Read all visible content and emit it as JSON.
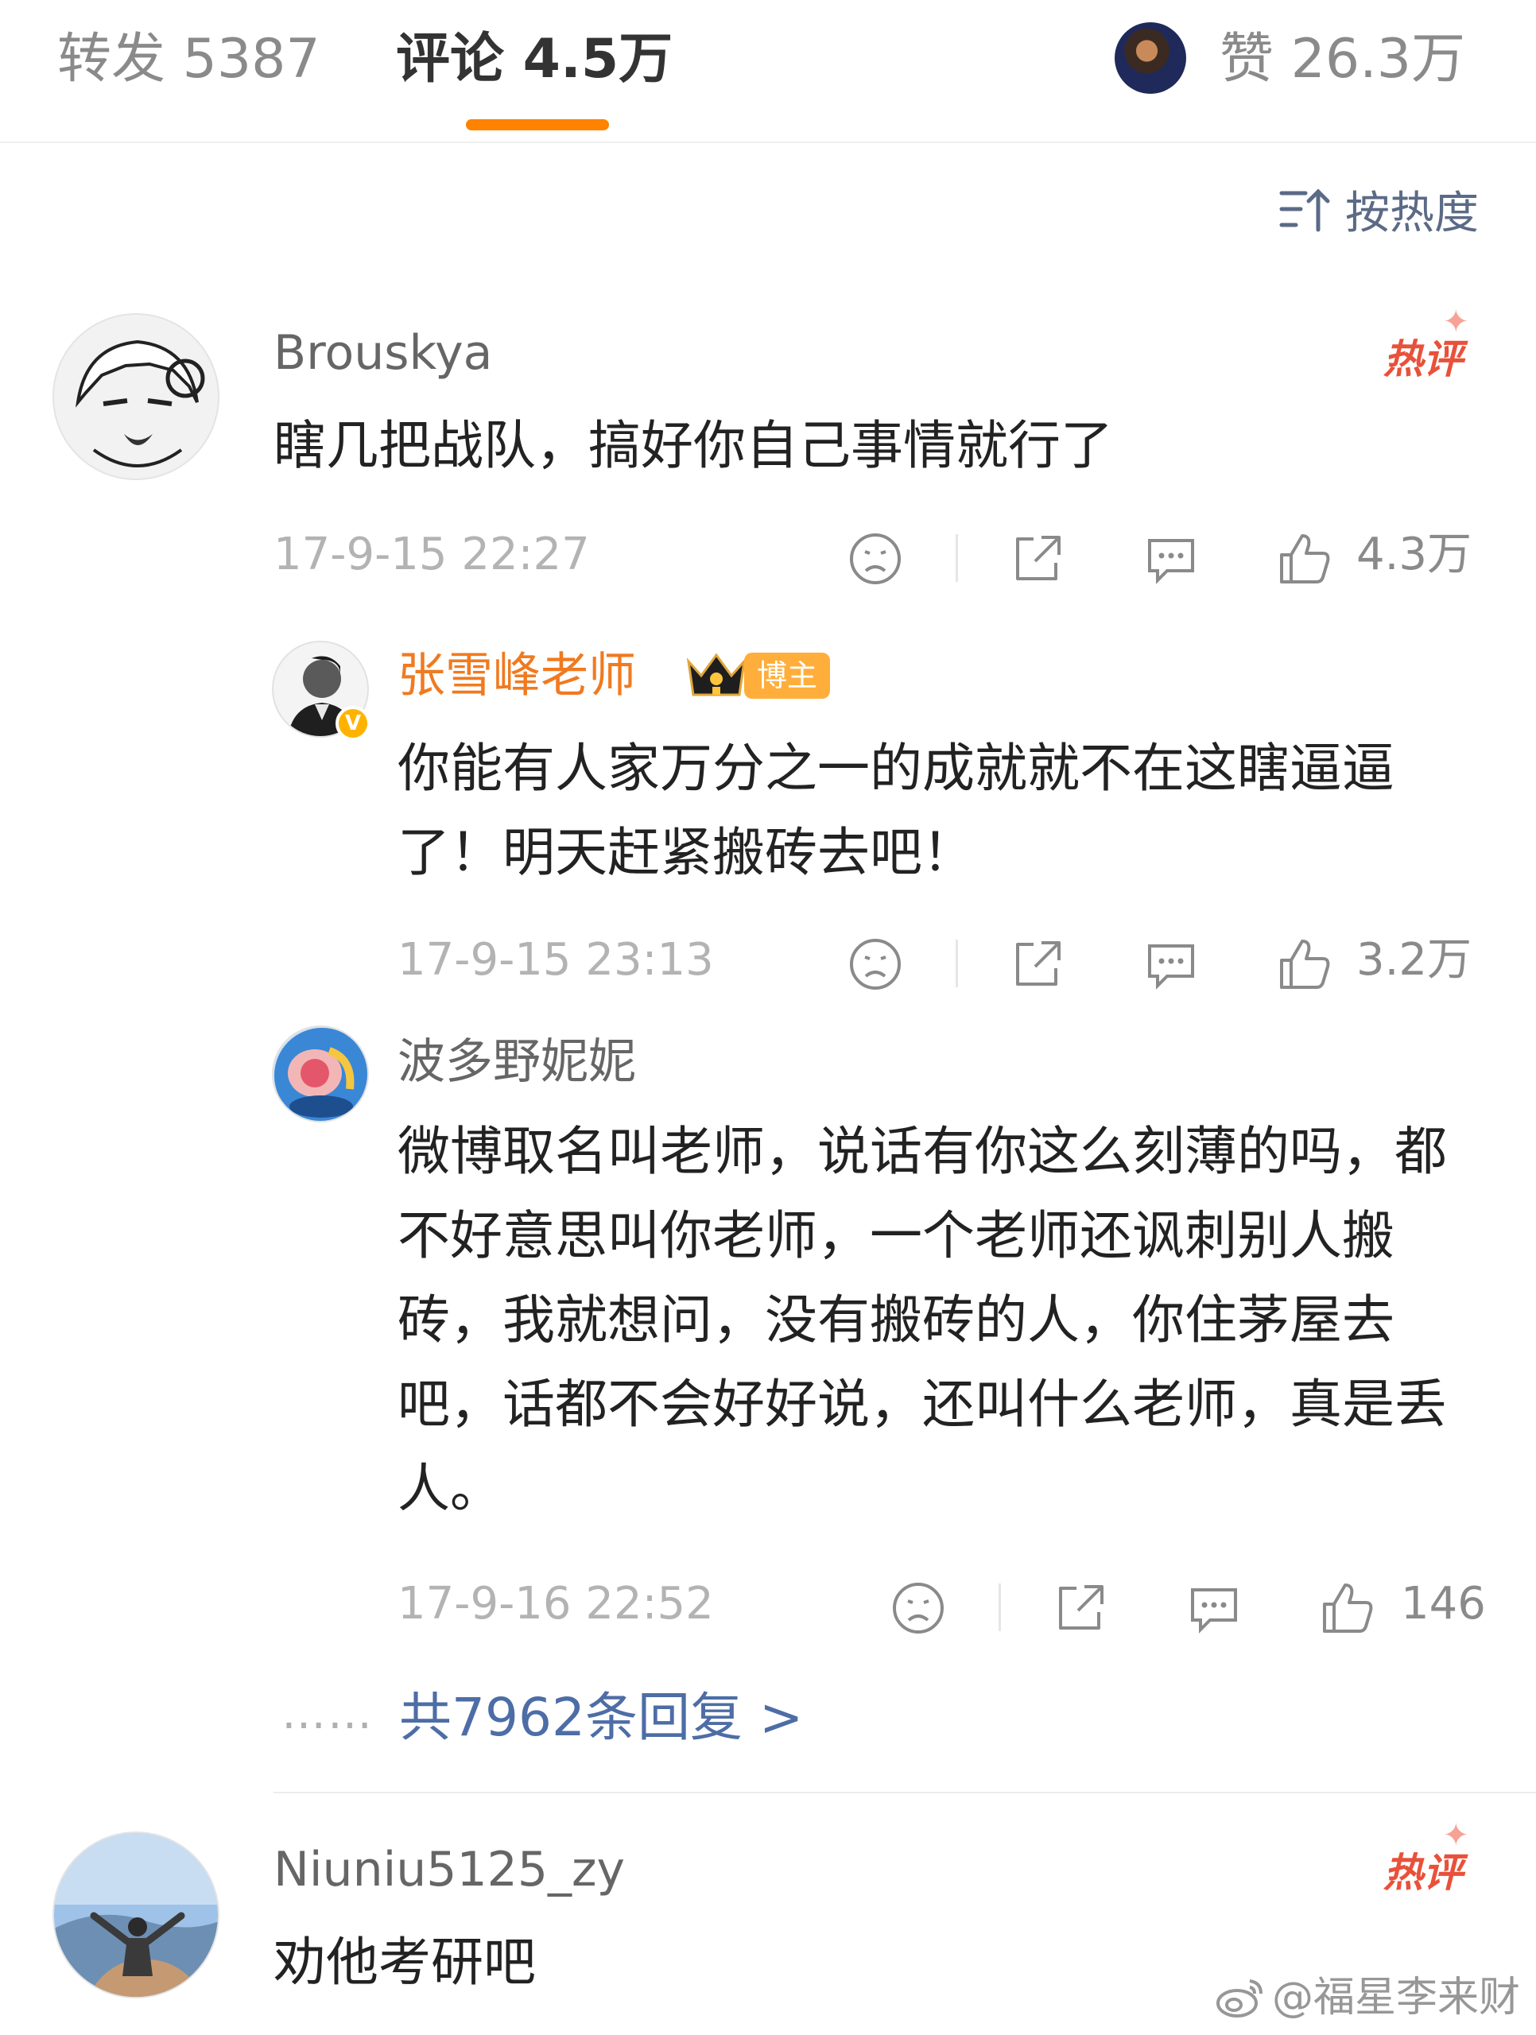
{
  "tabs": {
    "repost": "转发 5387",
    "comments": "评论 4.5万",
    "likes": "赞 26.3万"
  },
  "sort": {
    "label": "按热度"
  },
  "comments": [
    {
      "username": "Brouskya",
      "text": "瞎几把战队，搞好你自己事情就行了",
      "hot_badge": "热评",
      "time": "17-9-15 22:27",
      "likes": "4.3万",
      "replies": [
        {
          "username": "张雪峰老师",
          "badge": "博主",
          "verified": "V",
          "text": "你能有人家万分之一的成就就不在这瞎逼逼了！明天赶紧搬砖去吧！",
          "time": "17-9-15 23:13",
          "likes": "3.2万"
        },
        {
          "username": "波多野妮妮",
          "text": "微博取名叫老师，说话有你这么刻薄的吗，都不好意思叫你老师，一个老师还讽刺别人搬砖，我就想问，没有搬砖的人，你住茅屋去吧，话都不会好好说，还叫什么老师，真是丢人。",
          "time": "17-9-16 22:52",
          "likes": "146"
        }
      ],
      "more_replies": "共7962条回复 >",
      "more_dots": "……"
    },
    {
      "username": "Niuniu5125_zy",
      "text": "劝他考研吧",
      "hot_badge": "热评"
    }
  ],
  "watermark": "@福星李来财",
  "icons": {
    "sort": "sort-icon",
    "dislike": "dislike-face-icon",
    "share": "share-icon",
    "comment": "comment-icon",
    "like": "thumbs-up-icon",
    "crown": "crown-icon",
    "weibo": "weibo-logo-icon"
  },
  "colors": {
    "accent": "#ff8200",
    "author_name": "#f07a20",
    "hot_badge": "#e8513a",
    "link": "#4d6da6"
  }
}
